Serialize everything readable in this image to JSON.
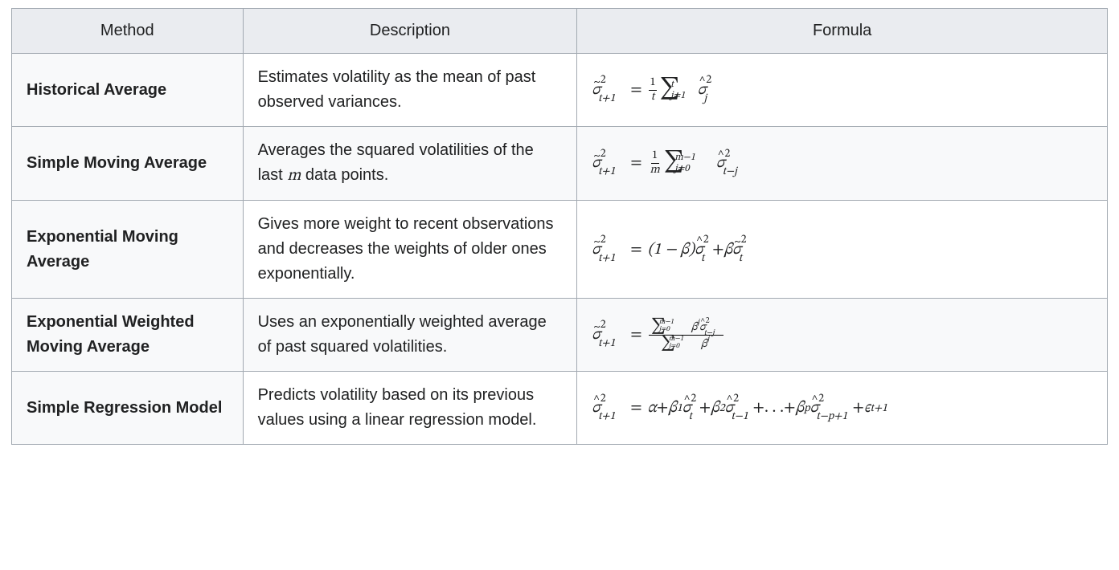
{
  "table": {
    "headers": {
      "method": "Method",
      "description": "Description",
      "formula": "Formula"
    },
    "rows": [
      {
        "method": "Historical Average",
        "description": "Estimates volatility as the mean of past observed variances.",
        "formula_tex": "\\tilde{\\sigma}_{t+1}^{2} = \\frac{1}{t} \\sum_{j=1}^{t} \\hat{\\sigma}_{j}^{2}",
        "sigma_lhs": {
          "accent": "~",
          "sup": "2",
          "sub": "t+1"
        },
        "frac": {
          "num": "1",
          "den": "t"
        },
        "sum": {
          "lo": "j=1",
          "hi": "t"
        },
        "sigma_rhs": {
          "accent": "^",
          "sup": "2",
          "sub": "j"
        },
        "rhs_pad_em": 0.6
      },
      {
        "method": "Simple Moving Average",
        "description_pre": "Averages the squared volatilities of the last ",
        "description_var": "m",
        "description_post": " data points.",
        "formula_tex": "\\tilde{\\sigma}_{t+1}^{2} = \\frac{1}{m} \\sum_{j=0}^{m-1} \\hat{\\sigma}_{t-j}^{2}",
        "sigma_lhs": {
          "accent": "~",
          "sup": "2",
          "sub": "t+1"
        },
        "frac": {
          "num": "1",
          "den": "m"
        },
        "sum": {
          "lo": "j=0",
          "hi": "m−1"
        },
        "sigma_rhs": {
          "accent": "^",
          "sup": "2",
          "sub": "t−j"
        },
        "rhs_pad_em": 1.2
      },
      {
        "method": "Exponential Moving Average",
        "description": "Gives more weight to recent observations and decreases the weights of older ones exponentially.",
        "formula_tex": "\\tilde{\\sigma}_{t+1}^{2} = (1-\\beta)\\hat{\\sigma}_{t}^{2} + \\beta\\tilde{\\sigma}_{t}^{2}",
        "sigma_lhs": {
          "accent": "~",
          "sup": "2",
          "sub": "t+1"
        },
        "coef1": "(1 − β)",
        "sigma_m1": {
          "accent": "^",
          "sup": "2",
          "sub": "t"
        },
        "plus": " + ",
        "coef2": "β",
        "sigma_m2": {
          "accent": "~",
          "sup": "2",
          "sub": "t"
        }
      },
      {
        "method": "Exponential Weighted Moving Average",
        "description": "Uses an exponentially weighted average of past squared volatilities.",
        "formula_tex": "\\tilde{\\sigma}_{t+1}^{2} = \\frac{\\sum_{j=0}^{m-1}\\beta^{j}\\hat{\\sigma}_{t-j}^{2}}{\\sum_{j=0}^{m-1}\\beta^{j}}",
        "sigma_lhs": {
          "accent": "~",
          "sup": "2",
          "sub": "t+1"
        },
        "num_sum": {
          "lo": "j=0",
          "hi": "m−1"
        },
        "num_beta": "β",
        "num_beta_sup": "j",
        "num_sigma": {
          "accent": "^",
          "sup": "2",
          "sub": "t−j"
        },
        "den_sum": {
          "lo": "j=0",
          "hi": "m−1"
        },
        "den_beta": "β",
        "den_beta_sup": "j"
      },
      {
        "method": "Simple Regression Model",
        "description": "Predicts volatility based on its previous values using a linear regression model.",
        "formula_tex": "\\hat{\\sigma}_{t+1}^{2} = \\alpha + \\beta_{1}\\hat{\\sigma}_{t}^{2} + \\beta_{2}\\hat{\\sigma}_{t-1}^{2} + \\ldots + \\beta_{p}\\hat{\\sigma}_{t-p+1}^{2} + \\epsilon_{t+1}",
        "sigma_lhs": {
          "accent": "^",
          "sup": "2",
          "sub": "t+1"
        },
        "alpha": "α",
        "plus": " + ",
        "terms": [
          {
            "beta_sub": "1",
            "sigma": {
              "accent": "^",
              "sup": "2",
              "sub": "t"
            },
            "pad_em": 0.4
          },
          {
            "beta_sub": "2",
            "sigma": {
              "accent": "^",
              "sup": "2",
              "sub": "t−1"
            },
            "pad_em": 1.1
          },
          {
            "ellipsis": ". . ."
          },
          {
            "beta_sub": "p",
            "sigma": {
              "accent": "^",
              "sup": "2",
              "sub": "t−p+1"
            },
            "pad_em": 2.0
          }
        ],
        "eps": "ϵ",
        "eps_sub": "t+1"
      }
    ]
  }
}
